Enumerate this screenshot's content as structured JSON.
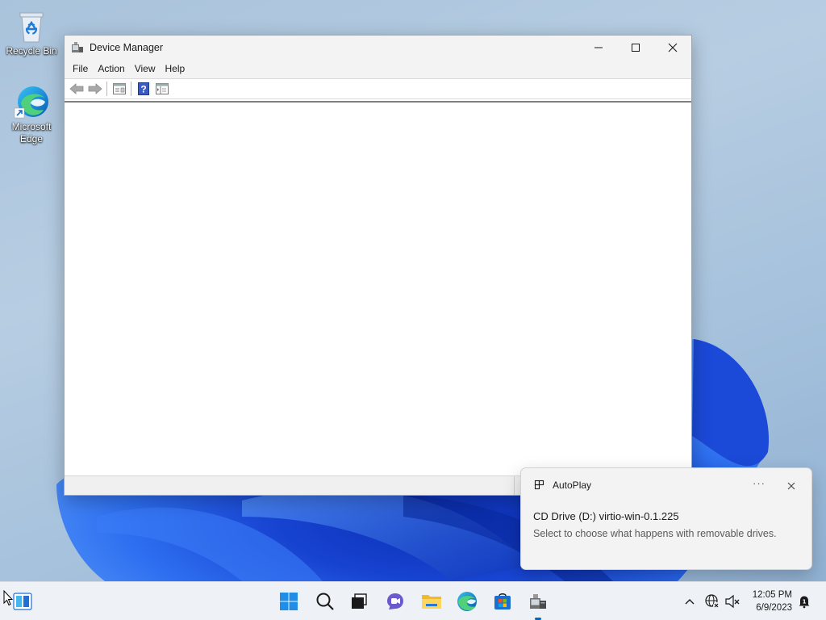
{
  "desktop": {
    "icons": [
      {
        "label": "Recycle Bin"
      },
      {
        "label": "Microsoft\nEdge"
      }
    ]
  },
  "window": {
    "title": "Device Manager",
    "menu": [
      "File",
      "Action",
      "View",
      "Help"
    ],
    "toolbar": [
      "back-icon",
      "forward-icon",
      "properties-icon",
      "help-icon",
      "show-hide-console-tree-icon"
    ]
  },
  "toast": {
    "app_name": "AutoPlay",
    "more_label": "···",
    "title": "CD Drive (D:) virtio-win-0.1.225",
    "body": "Select to choose what happens with removable drives."
  },
  "taskbar": {
    "apps": [
      "start-icon",
      "search-icon",
      "task-view-icon",
      "chat-icon",
      "file-explorer-icon",
      "edge-icon",
      "store-icon",
      "device-manager-icon"
    ],
    "tray_chevron": "^",
    "clock_time": "12:05 PM",
    "clock_date": "6/9/2023"
  },
  "colors": {
    "accent": "#0067c0",
    "wallpaper_blue": "#1a4fd6"
  }
}
